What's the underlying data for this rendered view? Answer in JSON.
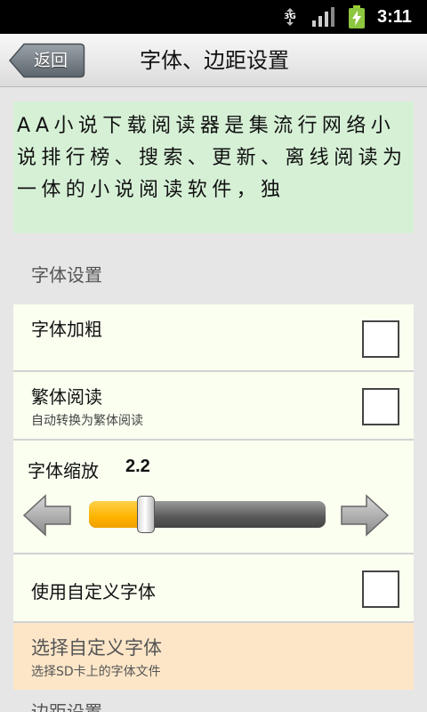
{
  "status_bar": {
    "network": "3G",
    "time": "3:11"
  },
  "header": {
    "back_label": "返回",
    "title": "字体、边距设置"
  },
  "preview": {
    "text": "AA小说下载阅读器是集流行网络小说排行榜、搜索、更新、离线阅读为一体的小说阅读软件，独"
  },
  "font_section": {
    "header": "字体设置",
    "bold": {
      "title": "字体加粗",
      "checked": false
    },
    "traditional": {
      "title": "繁体阅读",
      "summary": "自动转换为繁体阅读",
      "checked": false
    },
    "zoom": {
      "label": "字体缩放",
      "value": "2.2",
      "slider_fraction": 0.24
    },
    "custom_font": {
      "title": "使用自定义字体",
      "checked": false
    },
    "choose_font": {
      "title": "选择自定义字体",
      "summary": "选择SD卡上的字体文件"
    }
  },
  "next_section": {
    "header": "边距设置"
  },
  "colors": {
    "preview_bg": "#d6f0d6",
    "row_bg": "#fafff0",
    "highlight_bg": "#fde6c8",
    "slider_accent": "#ffb300"
  }
}
